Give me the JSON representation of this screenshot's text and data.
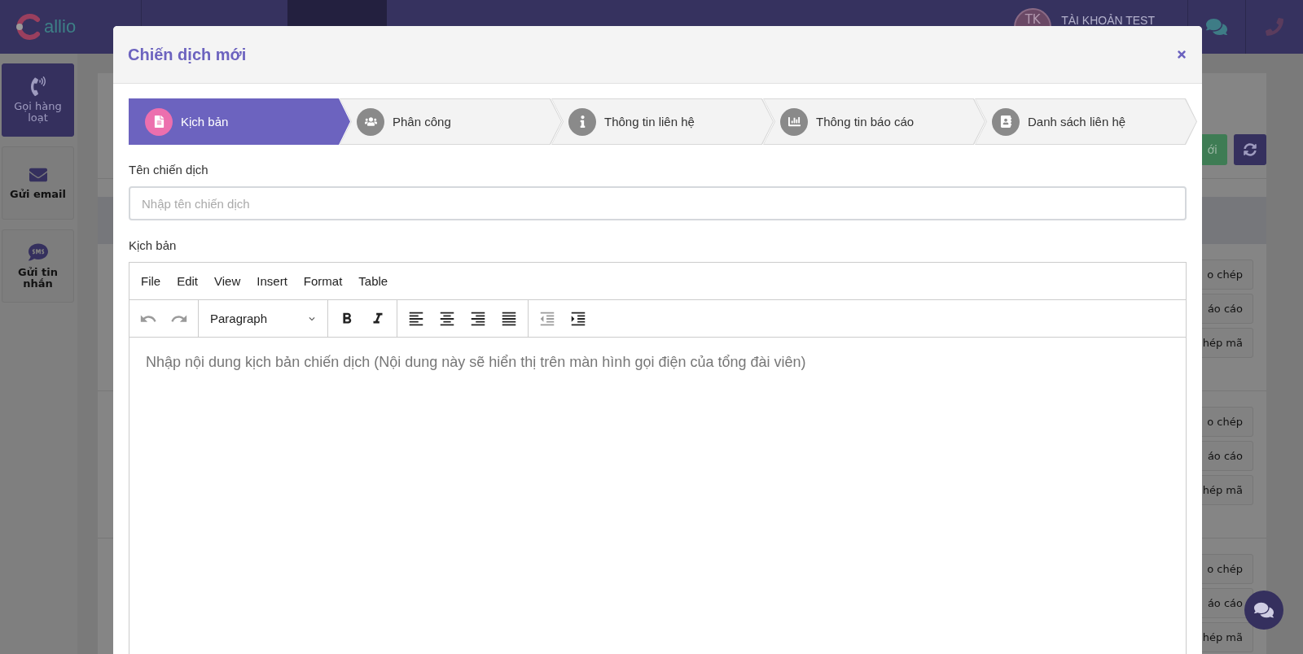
{
  "navbar": {
    "logo": "allio",
    "account": {
      "initials": "TK",
      "name": "TÀI KHOẢN TEST"
    }
  },
  "sidebar": {
    "items": [
      {
        "label": "Gọi hàng loạt",
        "kind": "phone",
        "selected": true
      },
      {
        "label": "Gửi email",
        "kind": "email",
        "selected": false
      },
      {
        "label": "Gửi tin nhắn",
        "kind": "sms",
        "selected": false
      }
    ]
  },
  "background": {
    "new_button": "ới",
    "card_groups": [
      [
        "o chép",
        "áo cáo",
        "hép mã"
      ],
      [
        "o chép",
        "áo cáo",
        "hép mã"
      ],
      [
        "o chép",
        "áo cáo",
        "hép mã"
      ]
    ]
  },
  "modal": {
    "title": "Chiến dịch mới",
    "steps": [
      {
        "label": "Kịch bản",
        "kind": "file",
        "selected": true
      },
      {
        "label": "Phân công",
        "kind": "users",
        "selected": false
      },
      {
        "label": "Thông tin liên hệ",
        "kind": "info",
        "selected": false
      },
      {
        "label": "Thông tin báo cáo",
        "kind": "chart",
        "selected": false
      },
      {
        "label": "Danh sách liên hệ",
        "kind": "contact",
        "selected": false
      }
    ],
    "name_field": {
      "label": "Tên chiến dịch",
      "placeholder": "Nhập tên chiến dịch"
    },
    "editor": {
      "label": "Kịch bản",
      "menu": [
        "File",
        "Edit",
        "View",
        "Insert",
        "Format",
        "Table"
      ],
      "format_select": "Paragraph",
      "toolbar_groups": [
        [
          {
            "kind": "undo",
            "disabled": true
          },
          {
            "kind": "redo",
            "disabled": true
          }
        ],
        [
          {
            "kind": "bold",
            "disabled": false
          },
          {
            "kind": "italic",
            "disabled": false
          }
        ],
        [
          {
            "kind": "align-left",
            "disabled": false
          },
          {
            "kind": "align-center",
            "disabled": false
          },
          {
            "kind": "align-right",
            "disabled": false
          },
          {
            "kind": "align-justify",
            "disabled": false
          }
        ],
        [
          {
            "kind": "outdent",
            "disabled": true
          },
          {
            "kind": "indent",
            "disabled": false
          }
        ]
      ],
      "placeholder": "Nhập nội dung kịch bản chiến dịch (Nội dung này sẽ hiển thị trên màn hình gọi điện của tổng đài viên)"
    }
  }
}
